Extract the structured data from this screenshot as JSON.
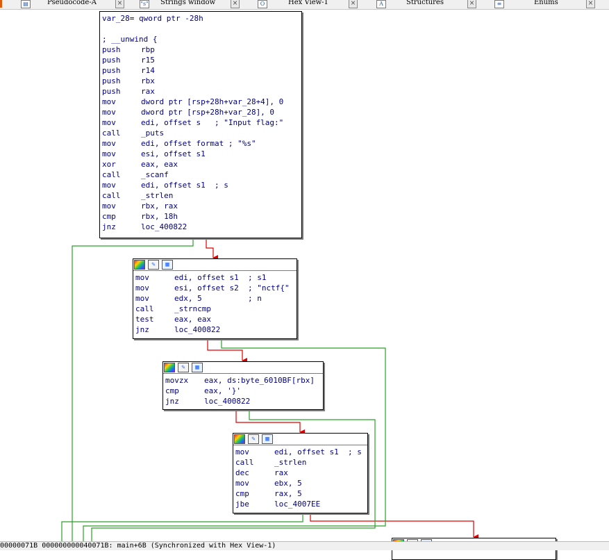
{
  "tabs": [
    {
      "label": "Pseudocode-A",
      "icon": "document-icon"
    },
    {
      "label": "Strings window",
      "icon": "strings-icon",
      "glyph": "\"s\""
    },
    {
      "label": "Hex View-1",
      "icon": "hex-view-icon",
      "glyph": "O"
    },
    {
      "label": "Structures",
      "icon": "structures-icon",
      "glyph": "A"
    },
    {
      "label": "Enums",
      "icon": "enums-icon",
      "glyph": "≡"
    }
  ],
  "tab_close_glyph": "×",
  "block_icons": {
    "color": "",
    "pencil": "✎",
    "graph": "▦"
  },
  "blocks": {
    "main": [
      {
        "line": "var_28= qword ptr -28h"
      },
      {
        "line": ""
      },
      {
        "line": "; __unwind {"
      },
      {
        "mn": "push",
        "op": "rbp"
      },
      {
        "mn": "push",
        "op": "r15"
      },
      {
        "mn": "push",
        "op": "r14"
      },
      {
        "mn": "push",
        "op": "rbx"
      },
      {
        "mn": "push",
        "op": "rax"
      },
      {
        "mn": "mov",
        "op": "dword ptr [rsp+28h+var_28+4], 0"
      },
      {
        "mn": "mov",
        "op": "dword ptr [rsp+28h+var_28], 0"
      },
      {
        "mn": "mov",
        "op": "edi, offset s   ; \"Input flag:\""
      },
      {
        "mn": "call",
        "op": "_puts"
      },
      {
        "mn": "mov",
        "op": "edi, offset format ; \"%s\""
      },
      {
        "mn": "mov",
        "op": "esi, offset s1"
      },
      {
        "mn": "xor",
        "op": "eax, eax"
      },
      {
        "mn": "call",
        "op": "_scanf"
      },
      {
        "mn": "mov",
        "op": "edi, offset s1  ; s"
      },
      {
        "mn": "call",
        "op": "_strlen"
      },
      {
        "mn": "mov",
        "op": "rbx, rax"
      },
      {
        "mn": "cmp",
        "op": "rbx, 18h"
      },
      {
        "mn": "jnz",
        "op": "loc_400822"
      }
    ],
    "b2": [
      {
        "mn": "mov",
        "op": "edi, offset s1  ; s1"
      },
      {
        "mn": "mov",
        "op": "esi, offset s2  ; \"nctf{\""
      },
      {
        "mn": "mov",
        "op": "edx, 5          ; n"
      },
      {
        "mn": "call",
        "op": "_strncmp"
      },
      {
        "mn": "test",
        "op": "eax, eax"
      },
      {
        "mn": "jnz",
        "op": "loc_400822"
      }
    ],
    "b3": [
      {
        "mn": "movzx",
        "op": "eax, ds:byte_6010BF[rbx]"
      },
      {
        "mn": "cmp",
        "op": "eax, '}'"
      },
      {
        "mn": "jnz",
        "op": "loc_400822"
      }
    ],
    "b4": [
      {
        "mn": "mov",
        "op": "edi, offset s1  ; s"
      },
      {
        "mn": "call",
        "op": "_strlen"
      },
      {
        "mn": "dec",
        "op": "rax"
      },
      {
        "mn": "mov",
        "op": "ebx, 5"
      },
      {
        "mn": "cmp",
        "op": "rax, 5"
      },
      {
        "mn": "jbe",
        "op": "loc_4007EE"
      }
    ]
  },
  "status_text": "00000071B 000000000040071B: main+6B (Synchronized with Hex View-1)",
  "colors": {
    "edge_true": "#2aa02a",
    "edge_false": "#e00000",
    "code": "#000080",
    "number": "#008000"
  }
}
